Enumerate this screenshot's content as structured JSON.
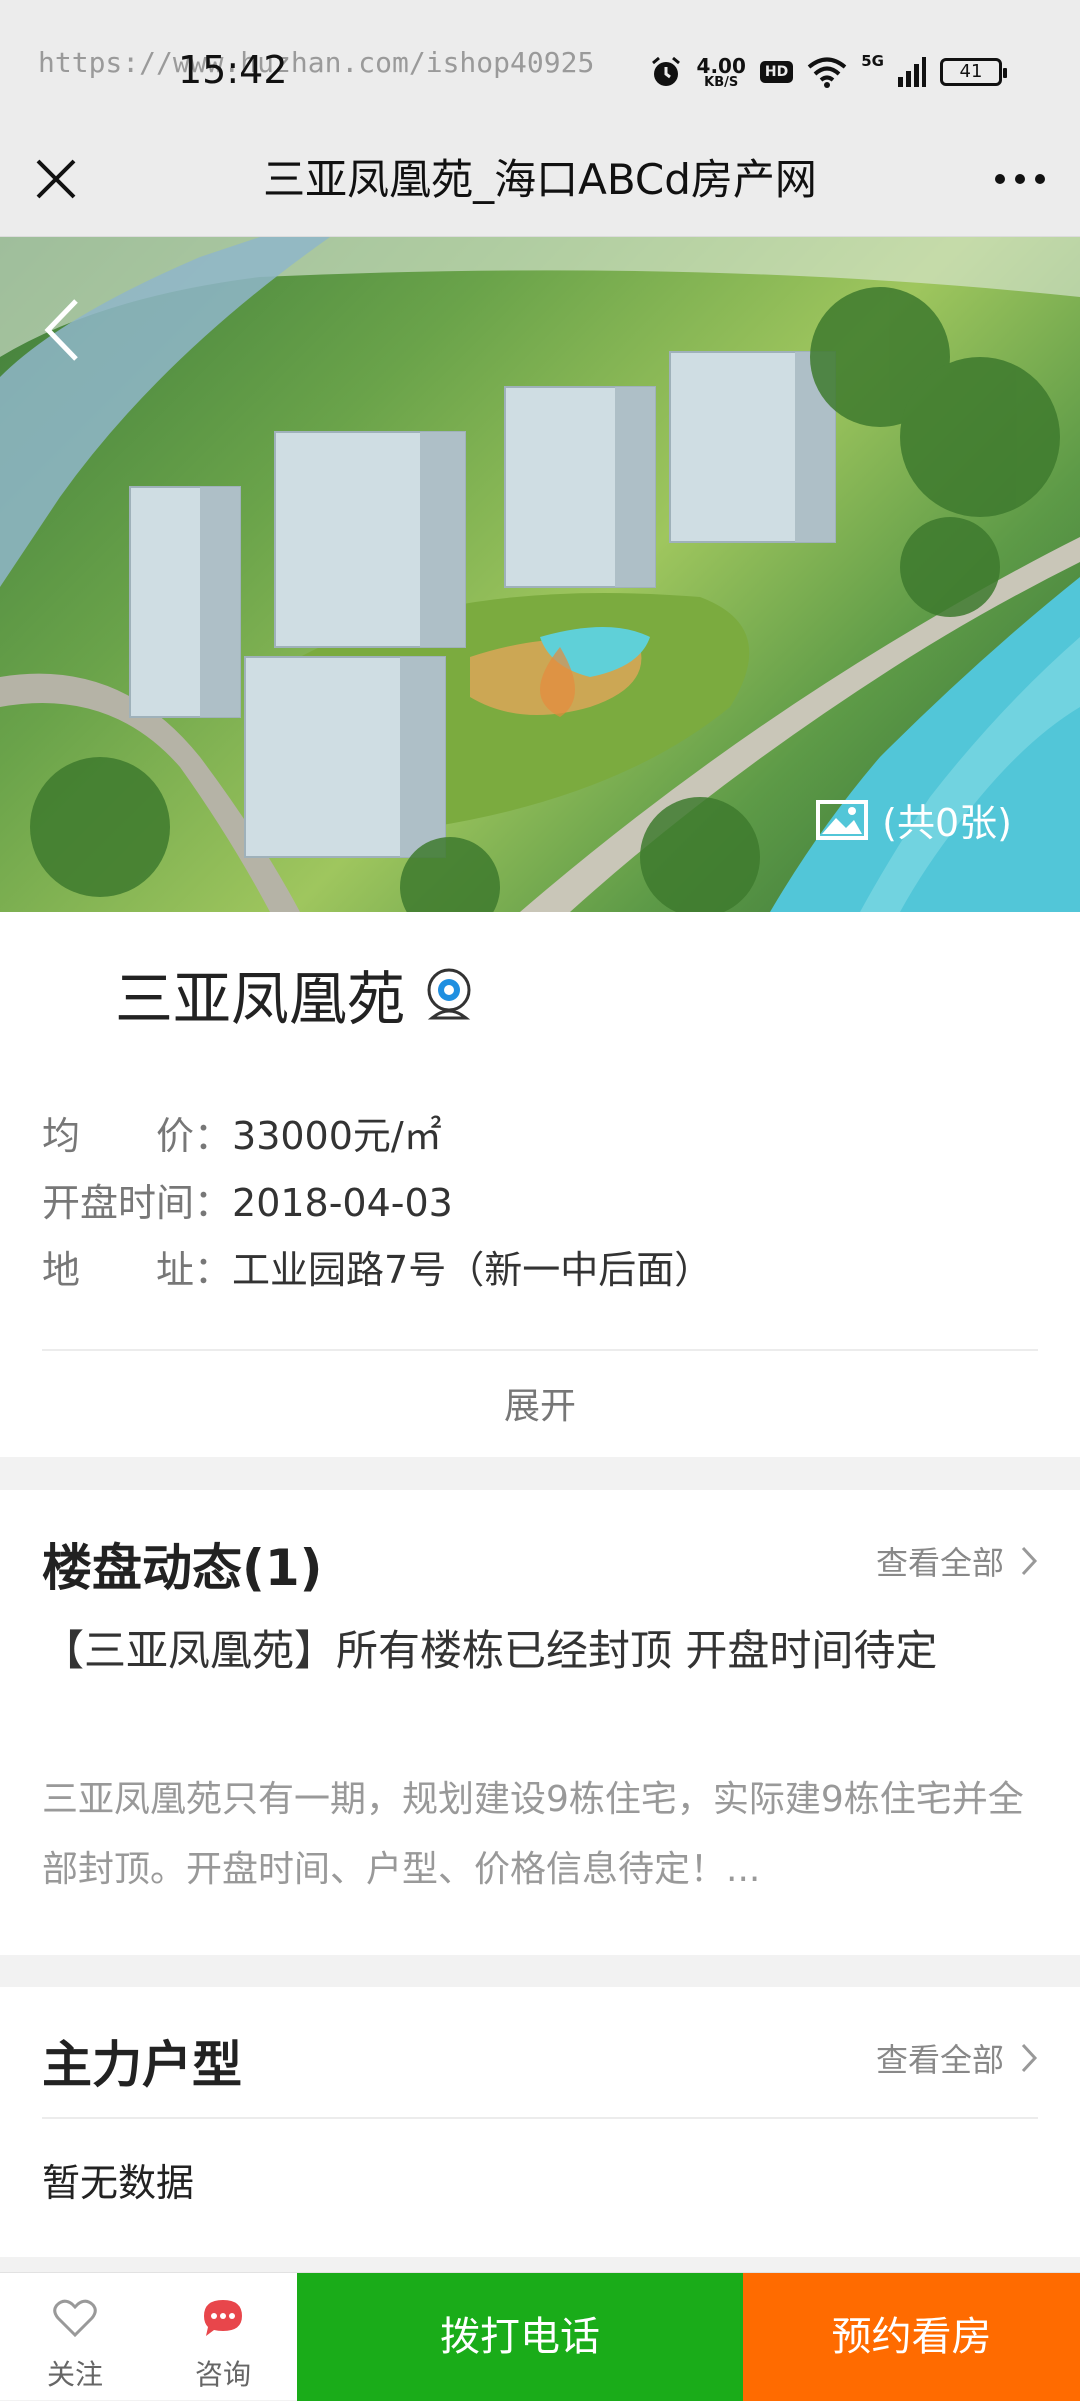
{
  "status_bar": {
    "watermark": "https://www.huzhan.com/ishop40925",
    "time": "15:42",
    "net_speed": "4.00",
    "net_unit": "KB/S",
    "hd": "HD",
    "signal": "5G",
    "battery": "41"
  },
  "nav": {
    "title": "三亚凤凰苑_海口ABCd房产网"
  },
  "hero": {
    "photo_count": "(共0张)"
  },
  "property": {
    "name": "三亚凤凰苑",
    "price_label": "均　　价：",
    "price_value": "33000元/㎡",
    "open_label": "开盘时间：",
    "open_value": "2018-04-03",
    "address_label": "地　　址：",
    "address_value": "工业园路7号（新一中后面）",
    "expand_label": "展开"
  },
  "news": {
    "title": "楼盘动态(1)",
    "see_all": "查看全部",
    "headline": "【三亚凤凰苑】所有楼栋已经封顶 开盘时间待定",
    "summary": "三亚凤凰苑只有一期，规划建设9栋住宅，实际建9栋住宅并全部封顶。开盘时间、户型、价格信息待定！..."
  },
  "layouts": {
    "title": "主力户型",
    "see_all": "查看全部",
    "empty": "暂无数据"
  },
  "bottom_bar": {
    "follow": "关注",
    "consult": "咨询",
    "call": "拨打电话",
    "book": "预约看房"
  },
  "colors": {
    "call_green": "#1aac19",
    "book_orange": "#ff6b00",
    "consult_red": "#e8464b"
  }
}
